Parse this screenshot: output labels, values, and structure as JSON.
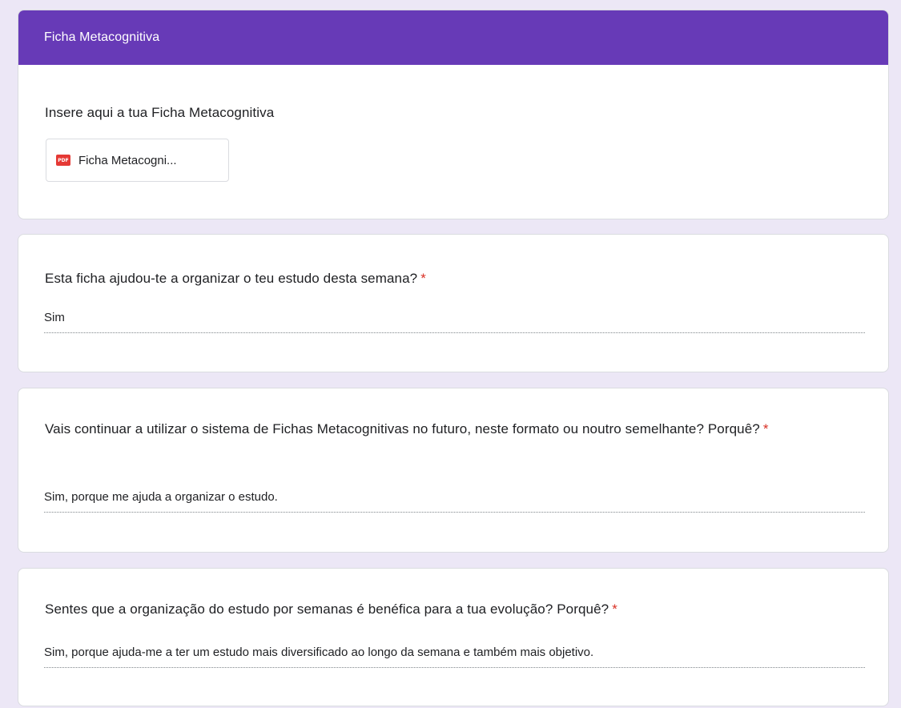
{
  "section": {
    "title": "Ficha Metacognitiva"
  },
  "upload": {
    "question": "Insere aqui a tua Ficha Metacognitiva",
    "file": {
      "icon": "pdf-icon",
      "icon_label": "PDF",
      "name": "Ficha Metacogni..."
    }
  },
  "questions": [
    {
      "text": "Esta ficha ajudou-te a organizar o teu estudo desta semana?",
      "required_mark": "*",
      "answer": "Sim"
    },
    {
      "text": "Vais continuar a utilizar o sistema de Fichas Metacognitivas no futuro, neste formato ou noutro semelhante? Porquê?",
      "required_mark": "*",
      "answer": "Sim, porque me ajuda a organizar o estudo."
    },
    {
      "text": "Sentes que a organização do estudo por semanas é benéfica para a tua evolução? Porquê?",
      "required_mark": "*",
      "answer": "Sim, porque ajuda-me a ter um estudo mais diversificado ao longo da semana e também mais objetivo."
    }
  ],
  "colors": {
    "header": "#673ab7",
    "background": "#ece7f6",
    "required": "#d93025",
    "pdf": "#e53935"
  }
}
